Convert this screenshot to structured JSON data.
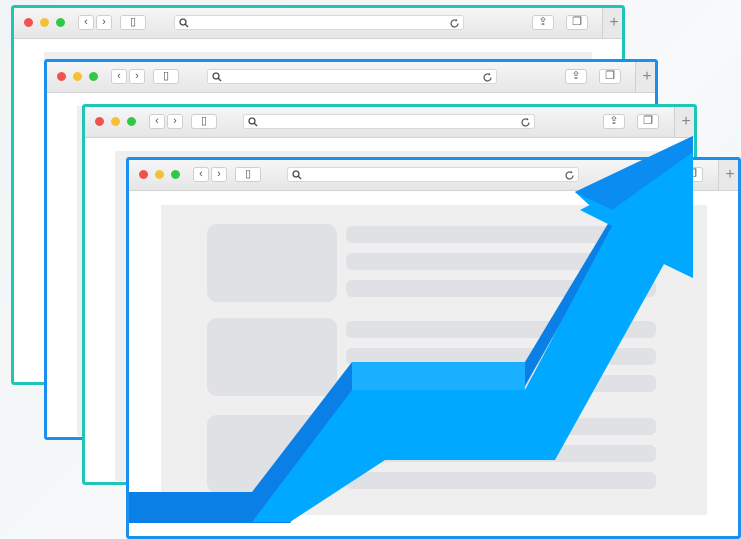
{
  "illustration": {
    "windows": [
      "browser-window-1",
      "browser-window-2",
      "browser-window-3",
      "browser-window-4"
    ],
    "colors": {
      "frame_teal": "#1fc6b8",
      "frame_blue": "#1a8ff0",
      "arrow_main": "#00a8ff",
      "arrow_shadow": "#0a7fe6",
      "placeholder": "#dfe1e4"
    },
    "icons": [
      "traffic-light-dots",
      "back-icon",
      "forward-icon",
      "sidebar-icon",
      "search-icon",
      "reload-icon",
      "share-icon",
      "tabs-icon",
      "new-tab-icon",
      "growth-arrow"
    ]
  }
}
